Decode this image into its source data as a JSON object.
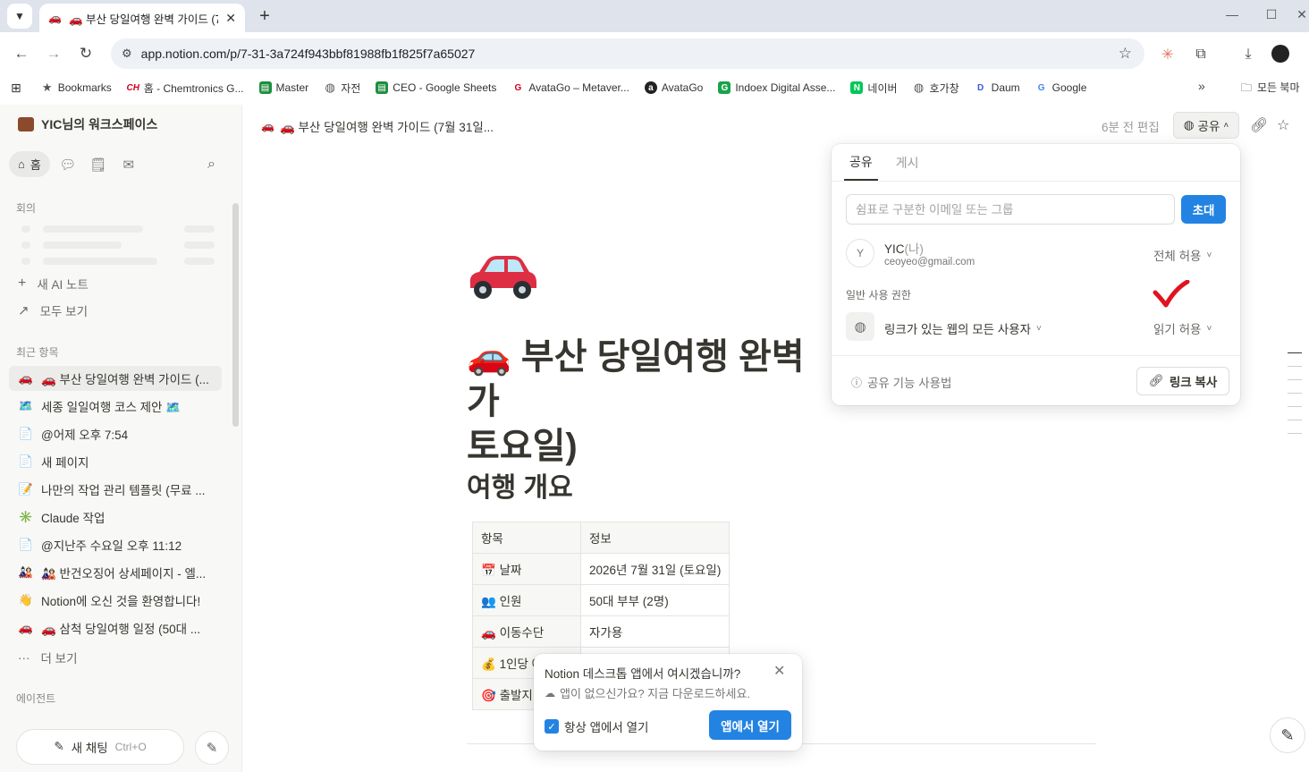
{
  "browser": {
    "tab_title": "🚗 부산 당일여행 완벽 가이드 (7월",
    "url": "app.notion.com/p/7-31-3a724f943bbf81988fb1f825f7a65027",
    "bookmarks": [
      {
        "label": "Bookmarks",
        "icon": "star-icon"
      },
      {
        "label": "홈 - Chemtronics G...",
        "icon": "ch-logo-icon"
      },
      {
        "label": "Master",
        "icon": "sheet-icon"
      },
      {
        "label": "자전",
        "icon": "globe-icon"
      },
      {
        "label": "CEO - Google Sheets",
        "icon": "sheets-icon"
      },
      {
        "label": "AvataGo – Metaver...",
        "icon": "avatago-icon"
      },
      {
        "label": "AvataGo",
        "icon": "avatago-icon"
      },
      {
        "label": "Indoex Digital Asse...",
        "icon": "indoex-icon"
      },
      {
        "label": "네이버",
        "icon": "naver-icon"
      },
      {
        "label": "호가창",
        "icon": "globe-icon"
      },
      {
        "label": "Daum",
        "icon": "daum-icon"
      },
      {
        "label": "Google",
        "icon": "google-icon"
      }
    ],
    "all_bookmarks": "모든 북마"
  },
  "sidebar": {
    "workspace": "YIC님의 워크스페이스",
    "home_label": "홈",
    "meetings_label": "회의",
    "new_ai_note": "새 AI 노트",
    "view_all": "모두 보기",
    "recent_label": "최근 항목",
    "recent_items": [
      {
        "icon": "🚗",
        "label": "🚗 부산 당일여행 완벽 가이드 (..."
      },
      {
        "icon": "🗺️",
        "label": "세종 일일여행 코스 제안 🗺️"
      },
      {
        "icon": "📄",
        "label": "@어제 오후 7:54"
      },
      {
        "icon": "📄",
        "label": "새 페이지"
      },
      {
        "icon": "📝",
        "label": "나만의 작업 관리 템플릿 (무료 ..."
      },
      {
        "icon": "✳️",
        "label": "Claude 작업"
      },
      {
        "icon": "📄",
        "label": "@지난주 수요일 오후 11:12"
      },
      {
        "icon": "🎎",
        "label": "🎎 반건오징어 상세페이지 - 엘..."
      },
      {
        "icon": "👋",
        "label": "Notion에 오신 것을 환영합니다!"
      },
      {
        "icon": "🚗",
        "label": "🚗 삼척 당일여행 일정 (50대 ..."
      }
    ],
    "more_label": "더 보기",
    "agents_label": "에이전트",
    "new_chat_label": "새 채팅",
    "new_chat_shortcut": "Ctrl+O"
  },
  "page": {
    "breadcrumb": "🚗 부산 당일여행 완벽 가이드 (7월 31일...",
    "edited": "6분 전 편집",
    "share_label": "공유",
    "title": "🚗 부산 당일여행 완벽 가\n토요일)",
    "section_heading": "여행 개요",
    "table": {
      "headers": [
        "항목",
        "정보"
      ],
      "rows": [
        {
          "icon": "📅",
          "key": "날짜",
          "value": "2026년 7월 31일 (토요일)"
        },
        {
          "icon": "👥",
          "key": "인원",
          "value": "50대 부부 (2명)"
        },
        {
          "icon": "🚗",
          "key": "이동수단",
          "value": "자가용"
        },
        {
          "icon": "💰",
          "key": "1인당 예",
          "value": ""
        },
        {
          "icon": "🎯",
          "key": "출발지",
          "value": ""
        }
      ]
    }
  },
  "share_popover": {
    "tabs": [
      "공유",
      "게시"
    ],
    "invite_placeholder": "쉼표로 구분한 이메일 또는 그룹",
    "invite_button": "초대",
    "member": {
      "avatar": "Y",
      "name": "YIC",
      "me_tag": "(나)",
      "email": "ceoyeo@gmail.com",
      "permission": "전체 허용"
    },
    "general_access_label": "일반 사용 권한",
    "general_access_value": "링크가 있는 웹의 모든 사용자",
    "general_permission": "읽기 허용",
    "help_label": "공유 기능 사용법",
    "copy_link_label": "링크 복사"
  },
  "toast": {
    "title": "Notion 데스크톱 앱에서 여시겠습니까?",
    "subtitle": "앱이 없으신가요? 지금 다운로드하세요.",
    "checkbox_label": "항상 앱에서 열기",
    "open_button": "앱에서 열기"
  },
  "colors": {
    "accent": "#2383e2",
    "sidebar_bg": "#f8f8f7",
    "tabbar_bg": "#dfe3eb",
    "check_red": "#e0141e"
  }
}
